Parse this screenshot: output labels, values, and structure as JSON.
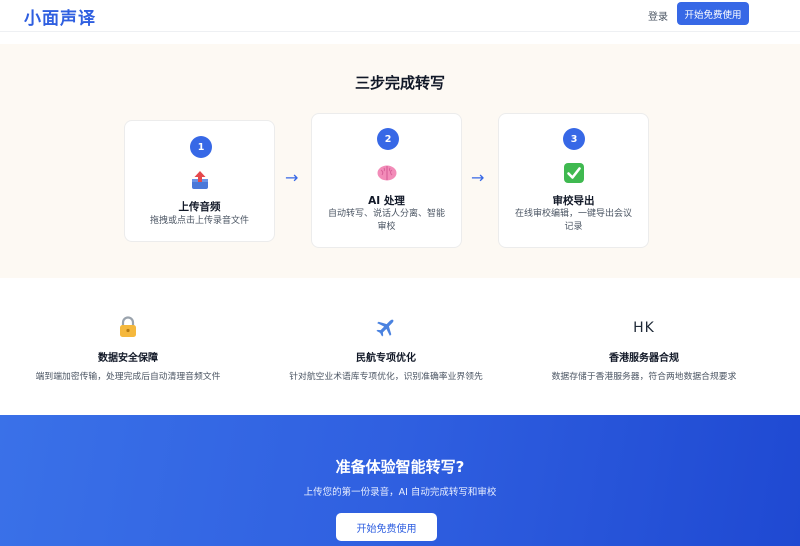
{
  "header": {
    "logo": "小面声译",
    "login_label": "登录",
    "cta_label": "开始免费使用"
  },
  "steps": {
    "title": "三步完成转写",
    "arrow": "→",
    "items": [
      {
        "number": "1",
        "icon": "upload-box-icon",
        "title": "上传音频",
        "description": "拖拽或点击上传录音文件"
      },
      {
        "number": "2",
        "icon": "brain-icon",
        "title": "AI 处理",
        "description": "自动转写、说话人分离、智能审校"
      },
      {
        "number": "3",
        "icon": "check-box-icon",
        "title": "审校导出",
        "description": "在线审校编辑，一键导出会议记录"
      }
    ]
  },
  "features": [
    {
      "icon": "lock-icon",
      "title": "数据安全保障",
      "description": "端到端加密传输，处理完成后自动清理音频文件"
    },
    {
      "icon": "airplane-icon",
      "title": "民航专项优化",
      "description": "针对航空业术语库专项优化，识别准确率业界领先"
    },
    {
      "icon": "hk-text-icon",
      "icon_text": "HK",
      "title": "香港服务器合规",
      "description": "数据存储于香港服务器，符合两地数据合规要求"
    }
  ],
  "banner": {
    "title": "准备体验智能转写?",
    "subtitle": "上传您的第一份录音，AI 自动完成转写和审校",
    "button_label": "开始免费使用"
  },
  "colors": {
    "accent": "#3768e6",
    "steps_bg": "#fdf9f3",
    "banner_start": "#3a71e8",
    "banner_end": "#1f49d2"
  }
}
